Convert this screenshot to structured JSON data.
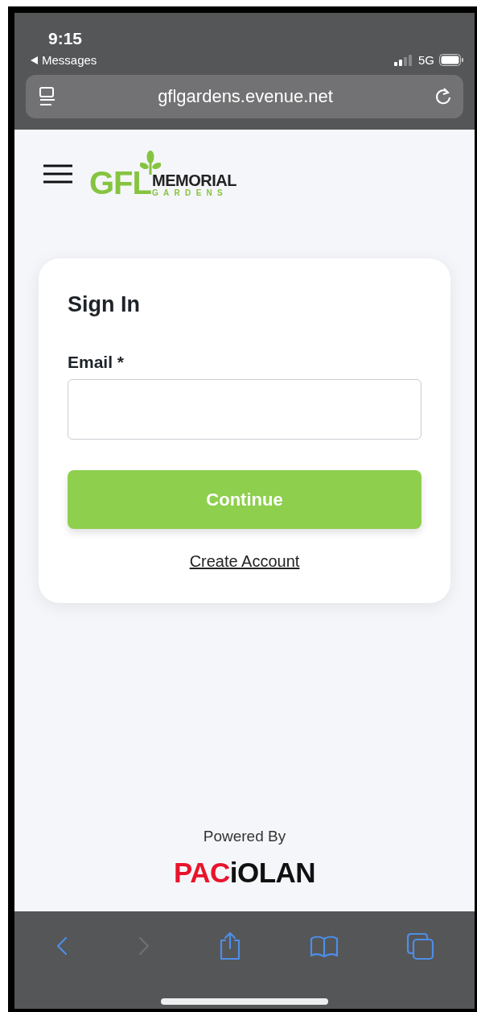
{
  "status_bar": {
    "time": "9:15",
    "back_label": "Messages",
    "network": "5G"
  },
  "address_bar": {
    "url": "gflgardens.evenue.net"
  },
  "site_header": {
    "logo": {
      "brand": "GFL",
      "line1": "MEMORIAL",
      "line2": "GARDENS"
    }
  },
  "sign_in": {
    "title": "Sign In",
    "email_label": "Email *",
    "button": "Continue",
    "link": "Create Account"
  },
  "footer": {
    "powered_by": "Powered By",
    "logo": {
      "part_red": "PAC",
      "part_black": "iOLAN"
    }
  },
  "toolbar": [
    {
      "kind": "back",
      "disabled": false
    },
    {
      "kind": "forward",
      "disabled": true
    },
    {
      "kind": "share",
      "disabled": false
    },
    {
      "kind": "bookmarks",
      "disabled": false
    },
    {
      "kind": "tabs",
      "disabled": false
    }
  ]
}
